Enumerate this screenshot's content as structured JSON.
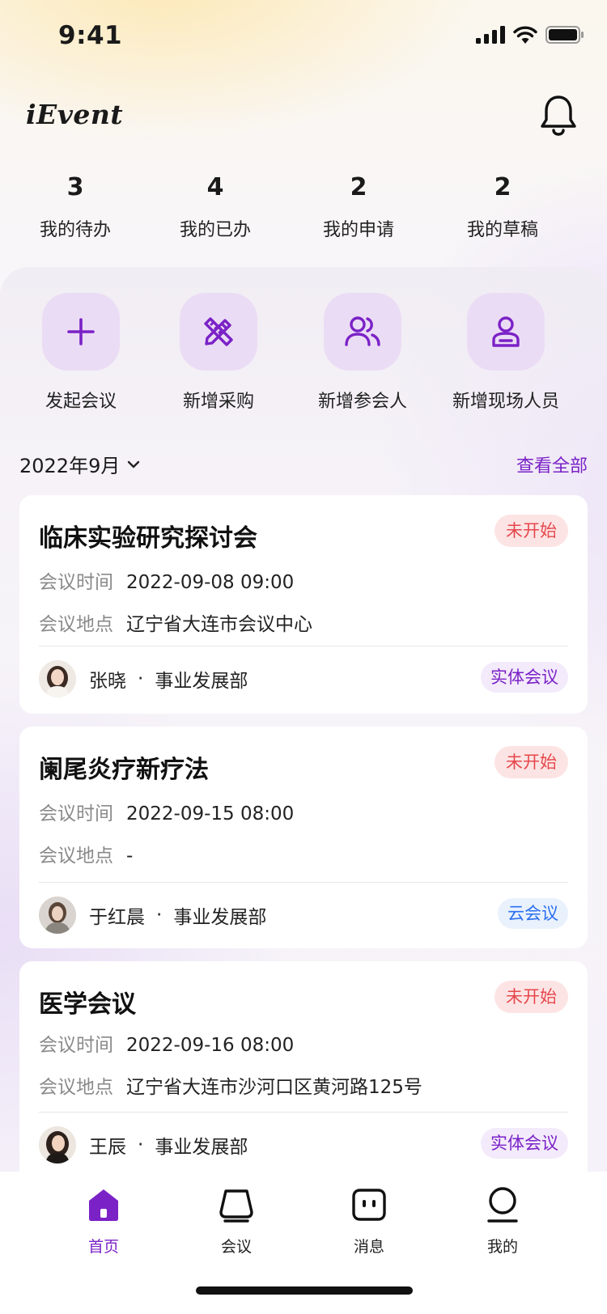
{
  "status_bar": {
    "time": "9:41"
  },
  "header": {
    "logo": "iEvent"
  },
  "stats": [
    {
      "count": "3",
      "label": "我的待办"
    },
    {
      "count": "4",
      "label": "我的已办"
    },
    {
      "count": "2",
      "label": "我的申请"
    },
    {
      "count": "2",
      "label": "我的草稿"
    }
  ],
  "quick_actions": [
    {
      "label": "发起会议",
      "icon": "plus-icon"
    },
    {
      "label": "新增采购",
      "icon": "pencil-ruler-icon"
    },
    {
      "label": "新增参会人",
      "icon": "users-icon"
    },
    {
      "label": "新增现场人员",
      "icon": "staff-icon"
    }
  ],
  "month_filter": {
    "label": "2022年9月",
    "view_all": "查看全部"
  },
  "meetings": [
    {
      "title": "临床实验研究探讨会",
      "status": "未开始",
      "time_label": "会议时间",
      "time": "2022-09-08 09:00",
      "location_label": "会议地点",
      "location": "辽宁省大连市会议中心",
      "organizer": "张晓",
      "department": "事业发展部",
      "type": "实体会议"
    },
    {
      "title": "阑尾炎疗新疗法",
      "status": "未开始",
      "time_label": "会议时间",
      "time": "2022-09-15 08:00",
      "location_label": "会议地点",
      "location": "-",
      "organizer": "于红晨",
      "department": "事业发展部",
      "type": "云会议"
    },
    {
      "title": "医学会议",
      "status": "未开始",
      "time_label": "会议时间",
      "time": "2022-09-16 08:00",
      "location_label": "会议地点",
      "location": "辽宁省大连市沙河口区黄河路125号",
      "organizer": "王辰",
      "department": "事业发展部",
      "type": "实体会议"
    }
  ],
  "tabbar": [
    {
      "label": "首页",
      "icon": "home-icon",
      "active": true
    },
    {
      "label": "会议",
      "icon": "meeting-icon",
      "active": false
    },
    {
      "label": "消息",
      "icon": "message-icon",
      "active": false
    },
    {
      "label": "我的",
      "icon": "profile-icon",
      "active": false
    }
  ],
  "colors": {
    "accent": "#7b22c7",
    "status_red": "#e5484d",
    "cloud_blue": "#2a6ff0"
  }
}
